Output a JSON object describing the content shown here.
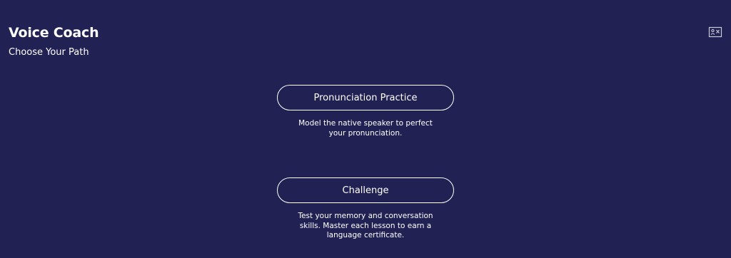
{
  "header": {
    "title": "Voice Coach",
    "subtitle": "Choose Your Path",
    "exit_icon": "exit-screen-icon"
  },
  "options": [
    {
      "label": "Pronunciation Practice",
      "description": "Model the native speaker to perfect your pronunciation."
    },
    {
      "label": "Challenge",
      "description": "Test your memory and conversation skills. Master each lesson to earn a language certificate."
    }
  ],
  "colors": {
    "background": "#212153",
    "text": "#ffffff",
    "icon": "#c9c9d8"
  }
}
